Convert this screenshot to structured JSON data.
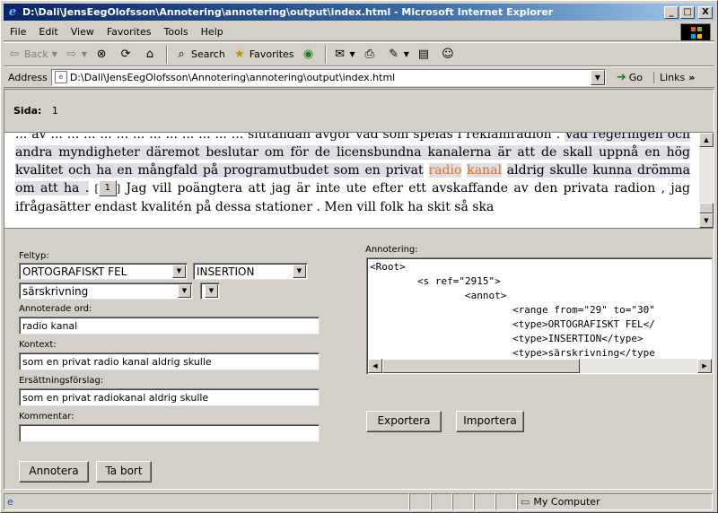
{
  "window": {
    "title": "D:\\Dali\\JensEegOlofsson\\Annotering\\annotering\\output\\index.html - Microsoft Internet Explorer",
    "min": "_",
    "max": "□",
    "close": "X"
  },
  "menu": {
    "file": "File",
    "edit": "Edit",
    "view": "View",
    "favorites": "Favorites",
    "tools": "Tools",
    "help": "Help"
  },
  "toolbar": {
    "back": "Back",
    "search": "Search",
    "favorites": "Favorites"
  },
  "address": {
    "label": "Address",
    "url": "D:\\Dali\\JensEegOlofsson\\Annotering\\annotering\\output\\index.html",
    "go": "Go",
    "links": "Links"
  },
  "page": {
    "sida_label": "Sida:",
    "sida_value": "1",
    "text": {
      "line0": "... av ... ...  ...  ... ... ... ... ...  ... ... ... ...",
      "seg1": "slutändan avgör vad som spelas i reklamradion .",
      "seg2": "Vad regeringen och andra myndigheter däremot beslutar om för de licensbundna kanalerna är att de skall uppnå en hög kvalitet och ha en mångfald på programutbudet som en privat",
      "word1": "radio",
      "word2": "kanal",
      "seg3": "aldrig skulle kunna drömma om att ha .",
      "bracket_open": "[",
      "num_button": "1",
      "bracket_close": "]",
      "seg4": "Jag vill poängtera att jag är inte ute efter ett avskaffande av den privata radion , jag ifrågasätter endast kvalitén på dessa stationer .",
      "seg5": "Men vill folk ha skit så ska"
    },
    "form": {
      "feltyp_label": "Feltyp:",
      "feltyp_value": "ORTOGRAFISKT FEL",
      "subtype_value": "INSERTION",
      "subsubtype_value": "särskrivning",
      "extra_value": "",
      "annoterade_label": "Annoterade ord:",
      "annoterade_value": "radio kanal",
      "kontext_label": "Kontext:",
      "kontext_value": "som en privat radio kanal aldrig skulle",
      "ersattning_label": "Ersättningsförslag:",
      "ersattning_value": "som en privat radiokanal aldrig skulle",
      "kommentar_label": "Kommentar:",
      "kommentar_value": "",
      "annotera_btn": "Annotera",
      "tabort_btn": "Ta bort"
    },
    "annotering": {
      "label": "Annotering:",
      "xml": "<Root>\n        <s ref=\"2915\">\n                <annot>\n                        <range from=\"29\" to=\"30\"\n                        <type>ORTOGRAFISKT FEL</\n                        <type>INSERTION</type>\n                        <type>särskrivning</type",
      "export_btn": "Exportera",
      "import_btn": "Importera"
    }
  },
  "status": {
    "zone": "My Computer"
  }
}
